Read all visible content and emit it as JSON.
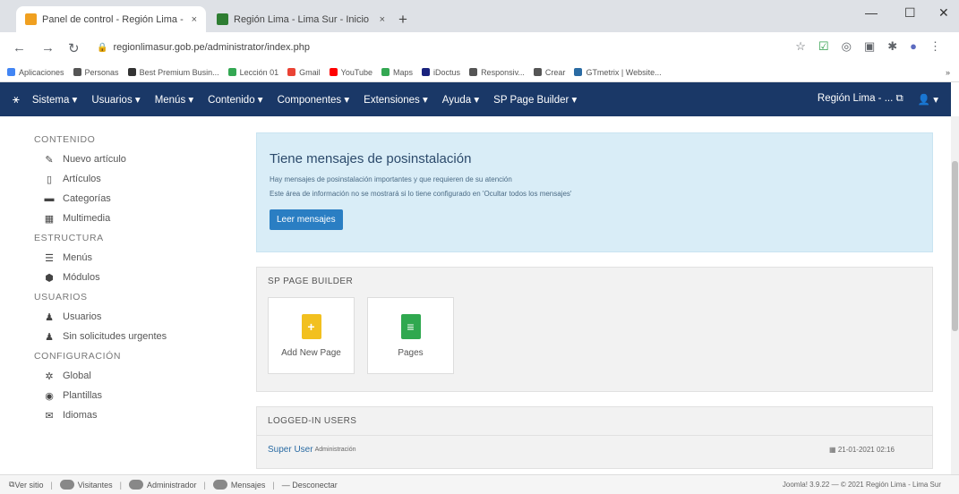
{
  "browser": {
    "tabs": [
      {
        "title": "Panel de control - Región Lima - ",
        "close": "×",
        "favicon_color": "#f0a020"
      },
      {
        "title": "Región Lima - Lima Sur - Inicio",
        "close": "×",
        "favicon_color": "#2e7d32"
      }
    ],
    "new_tab": "+",
    "url": "regionlimasur.gob.pe/administrator/index.php",
    "bookmarks": [
      "Aplicaciones",
      "Personas",
      "Best Premium Busin...",
      "Lección 01",
      "Gmail",
      "YouTube",
      "Maps",
      "iDoctus",
      "Responsiv...",
      "Crear",
      "GTmetrix | Website..."
    ],
    "bookmark_colors": [
      "#4285f4",
      "#555555",
      "#333333",
      "#34a853",
      "#ea4335",
      "#ff0000",
      "#34a853",
      "#1a237e",
      "#555555",
      "#555555",
      "#2a6ba3"
    ],
    "more_bookmarks": "»"
  },
  "topnav": {
    "logo": "⚹",
    "menus": [
      "Sistema ▾",
      "Usuarios ▾",
      "Menús ▾",
      "Contenido ▾",
      "Componentes ▾",
      "Extensiones ▾",
      "Ayuda ▾",
      "SP Page Builder ▾"
    ],
    "site": "Región Lima - ... ⧉",
    "user": "👤 ▾"
  },
  "sidebar": {
    "sections": [
      {
        "title": "CONTENIDO",
        "items": [
          {
            "icon": "✎",
            "label": "Nuevo artículo"
          },
          {
            "icon": "▯",
            "label": "Artículos"
          },
          {
            "icon": "▬",
            "label": "Categorías"
          },
          {
            "icon": "▦",
            "label": "Multimedia"
          }
        ]
      },
      {
        "title": "ESTRUCTURA",
        "items": [
          {
            "icon": "☰",
            "label": "Menús"
          },
          {
            "icon": "⬢",
            "label": "Módulos"
          }
        ]
      },
      {
        "title": "USUARIOS",
        "items": [
          {
            "icon": "♟",
            "label": "Usuarios"
          },
          {
            "icon": "♟",
            "label": "Sin solicitudes urgentes"
          }
        ]
      },
      {
        "title": "CONFIGURACIÓN",
        "items": [
          {
            "icon": "✲",
            "label": "Global"
          },
          {
            "icon": "◉",
            "label": "Plantillas"
          },
          {
            "icon": "✉",
            "label": "Idiomas"
          }
        ]
      }
    ]
  },
  "alert": {
    "title": "Tiene mensajes de posinstalación",
    "line1": "Hay mensajes de posinstalación importantes y que requieren de su atención",
    "line2": "Este área de información no se mostrará si lo tiene configurado en 'Ocultar todos los mensajes'",
    "button": "Leer mensajes"
  },
  "sppb": {
    "title": "SP PAGE BUILDER",
    "cards": [
      {
        "label": "Add New Page",
        "glyph": "+",
        "color": "#f2c01f"
      },
      {
        "label": "Pages",
        "glyph": "≡",
        "color": "#2fa84f"
      }
    ]
  },
  "logged": {
    "title": "LOGGED-IN USERS",
    "user": "Super User",
    "role": "Administración",
    "date": "21-01-2021 02:16"
  },
  "status": {
    "items": [
      "Ver sitio",
      "Visitantes",
      "Administrador",
      "Mensajes",
      "— Desconectar"
    ],
    "copyright": "Joomla! 3.9.22 — © 2021 Región Lima - Lima Sur"
  }
}
